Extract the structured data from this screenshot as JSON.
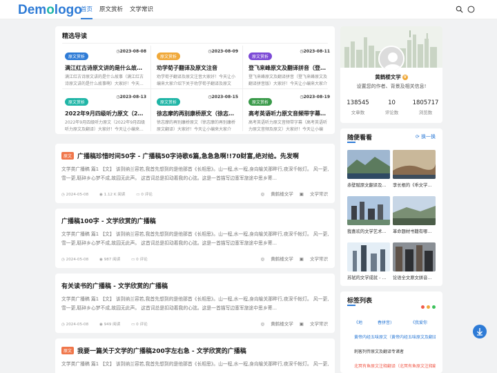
{
  "header": {
    "logo": "Demologo",
    "nav": [
      "首页",
      "原文赏析",
      "文学常识"
    ],
    "icons": [
      "search-icon",
      "theme-toggle-icon"
    ]
  },
  "guide": {
    "title": "精选导读",
    "items": [
      {
        "tag": "原文赏析",
        "tag_color": "#2e7bd6",
        "date": "2023-08-08",
        "title": "满江红古诗原文讲的是什么故事（满江...",
        "desc": "满江红古诗原文讲的是什么故事（满江红古诗原文讲的是什么故事啊）大家好！今天..."
      },
      {
        "tag": "原文赏析",
        "tag_color": "#f0a93a",
        "date": "2023-08-09",
        "title": "劝学荀子翻译及原文注音",
        "desc": "劝学荀子翻译及原文注音大家好！今天让小编来大家介绍下关于劝学荀子翻译及原文注..."
      },
      {
        "tag": "原文赏析",
        "tag_color": "#7c4ad6",
        "date": "2023-08-11",
        "title": "登飞来峰原文及翻译拼音（登飞来峰原...",
        "desc": "登飞来峰原文及翻译拼音（登飞来峰原文及翻译拼音版）大家好！今天让小编来大家介绍..."
      },
      {
        "tag": "原文赏析",
        "tag_color": "#1fb5a6",
        "date": "2023-08-13",
        "title": "2022年9月四级听力原文（2022年9月...",
        "desc": "2022年9月四级听力原文（2022年9月四级听力原文及翻译）大家好！今天让小编来..."
      },
      {
        "tag": "原文赏析",
        "tag_color": "#1fb5a6",
        "date": "2023-08-15",
        "title": "徐志摩的再别康桥原文（徐志摩的再别...",
        "desc": "徐志摩的再别康桥原文（徐志摩的再别康桥原文翻译）大家好！今天让小编来大家介绍..."
      },
      {
        "tag": "原文赏析",
        "tag_color": "#3a9a4a",
        "date": "2023-08-19",
        "title": "高考英语听力原文音频带字幕（高考英...",
        "desc": "高考英语听力原文音频带字幕（高考英语听力原文音频及原文）大家好！今天让小编来..."
      }
    ]
  },
  "posts": [
    {
      "tag": "原文",
      "title": "广播稿珍惜时间50字 - 广播稿50字诗歌6篇,急急急啊!!70财富,绝对给。先发啊",
      "excerpt": "文学类广播稿 篇1 【文】 该到纳兰容若,我首先想到的是他那首《长相思》。山一程,水一程,身向榆关那畔行,夜深千帐灯。 风一更,雪一更,聒碎乡心梦不成,故园无此声。 这首词总是扣动着我的心弦。这是一首描写边塞军旅途中思乡寄...",
      "date": "2024-05-08",
      "reads": "1.12 K 阅读",
      "comments": "0 评论",
      "author": "黄鹤楼文学",
      "category": "文学常识"
    },
    {
      "tag": "",
      "title": "广播稿100字 - 文学欣赏的广播稿",
      "excerpt": "文学类广播稿 篇1 【文】 该到纳兰容若,我首先想到的是他那首《长相思》。山一程,水一程,身向榆关那畔行,夜深千帐灯。 风一更,雪一更,聒碎乡心梦不成,故园无此声。 这首词总是扣动着我的心弦。这是一首描写边塞军旅途中思乡寄...",
      "date": "2024-05-08",
      "reads": "987 阅读",
      "comments": "0 评论",
      "author": "黄鹤楼文学",
      "category": "文学常识"
    },
    {
      "tag": "",
      "title": "有关读书的广播稿 - 文学欣赏的广播稿",
      "excerpt": "文学类广播稿 篇1 【文】 该到纳兰容若,我首先想到的是他那首《长相思》。山一程,水一程,身向榆关那畔行,夜深千帐灯。 风一更,雪一更,聒碎乡心梦不成,故园无此声。 这首词总是扣动着我的心弦。这是一首描写边塞军旅途中思乡寄...",
      "date": "2024-05-08",
      "reads": "949 阅读",
      "comments": "0 评论",
      "author": "黄鹤楼文学",
      "category": "文学常识"
    },
    {
      "tag": "原文",
      "title": "我要一篇关于文学的广播稿200字左右急 - 文学欣赏的广播稿",
      "excerpt": "文学类广播稿 篇1 【文】 该到纳兰容若,我首先想到的是他那首《长相思》。山一程,水一程,身向榆关那畔行,夜深千帐灯。 风一更,雪一更,聒碎乡心梦不成,故园无此声。 这首词总是扣动着我的心弦。这是一首描写边塞军旅途中思乡寄...",
      "date": "",
      "reads": "",
      "comments": "",
      "author": "",
      "category": ""
    }
  ],
  "profile": {
    "name": "黄鹤楼文学",
    "badge": "V",
    "desc": "设置您的作者、背景及相关信息!",
    "stats": [
      {
        "num": "138545",
        "label": "文章数"
      },
      {
        "num": "10",
        "label": "评论数"
      },
      {
        "num": "1805717",
        "label": "浏览数"
      }
    ]
  },
  "random": {
    "title": "随便看看",
    "swap_label": "换一换",
    "items": [
      {
        "caption": "赤壁赋原文翻译及...",
        "colors": [
          "#9fb7d0",
          "#5c7b5e",
          "#2f4a63"
        ]
      },
      {
        "caption": "李长根的《乖文学...",
        "colors": [
          "#c9b89a",
          "#8a6c4f",
          "#3d4d5c"
        ]
      },
      {
        "caption": "我喜欢的文学艺术...",
        "colors": [
          "#aec6e0",
          "#6a8a6f",
          "#3b3f46"
        ]
      },
      {
        "caption": "革命题材书籍有哪...",
        "colors": [
          "#c7d6e6",
          "#7a8f74",
          "#4b5d48"
        ]
      },
      {
        "caption": "苏轼的文学成就 - ...",
        "colors": [
          "#e4eef6",
          "#6d7c8c",
          "#3d4a57"
        ]
      },
      {
        "caption": "论语全文原文拼音...",
        "colors": [
          "#8a8f95",
          "#5f5248",
          "#2d2f33"
        ]
      }
    ]
  },
  "tags": {
    "title": "标签列表",
    "dot_colors": [
      "#f05a4a",
      "#f0a93a",
      "#3ac15a"
    ],
    "items": [
      {
        "label": "《地",
        "color": "#2e7bd6"
      },
      {
        "label": "春拼音)",
        "color": "#2e7bd6"
      },
      {
        "label": "《我爱你",
        "color": "#2e7bd6"
      },
      {
        "label": "黄帝内经五味原文（黄帝内经五味原文及翻译）",
        "color": "#2e7bd6"
      },
      {
        "label": "刺客列传原文及翻译专诸者",
        "color": "#333333"
      },
      {
        "label": "北冥有鱼原文注释翻译（北冥有鱼原文注释翻译）",
        "color": "#f05a4a"
      }
    ]
  }
}
